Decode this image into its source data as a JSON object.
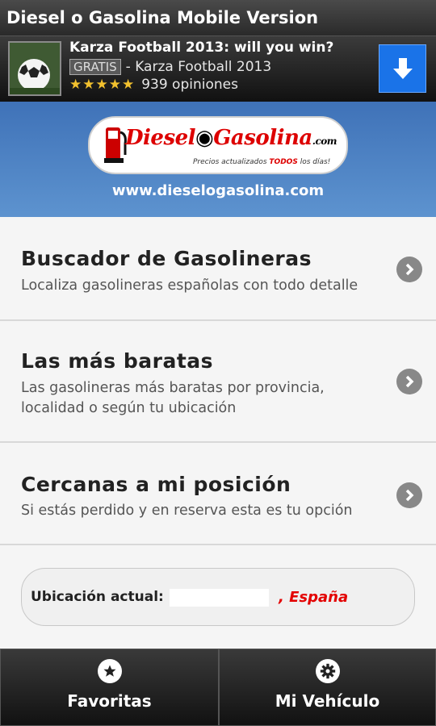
{
  "app": {
    "title": "Diesel o Gasolina Mobile Version"
  },
  "ad": {
    "title": "Karza Football 2013: will you win?",
    "badge": "GRATIS",
    "publisher": "- Karza Football 2013",
    "stars": "★★★★★",
    "rating": 4.5,
    "reviews": "939 opiniones",
    "download_icon": "download-arrow-icon",
    "accent": "#1a73e8"
  },
  "header": {
    "logo": {
      "brand_left": "Diesel",
      "brand_right": "Gasolina",
      "brand_suffix": ".com",
      "tagline_pre": "Precios actualizados",
      "tagline_bold": "TODOS",
      "tagline_post": "los días!"
    },
    "url": "www.dieselogasolina.com"
  },
  "menu": {
    "items": [
      {
        "title": "Buscador de Gasolineras",
        "description": [
          "Localiza gasolineras españolas con todo detalle"
        ]
      },
      {
        "title": "Las más baratas",
        "description": [
          "Las gasolineras más baratas por provincia,",
          "localidad o según tu ubicación"
        ]
      },
      {
        "title": "Cercanas a mi posición",
        "description": [
          "Si estás perdido y en reserva esta es tu opción"
        ]
      }
    ]
  },
  "location": {
    "label": "Ubicación actual:",
    "country": ", España",
    "country_color": "#e30000"
  },
  "tabs": [
    {
      "label": "Favoritas",
      "icon": "star-icon"
    },
    {
      "label": "Mi Vehículo",
      "icon": "gear-icon"
    }
  ]
}
